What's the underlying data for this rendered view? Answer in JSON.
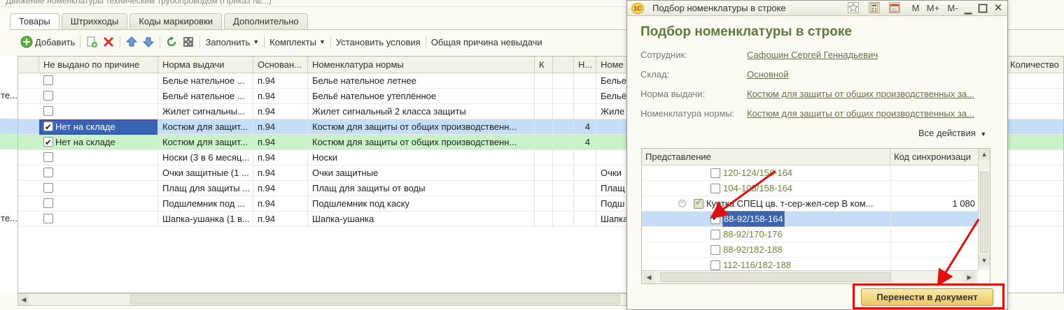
{
  "main": {
    "window_title_fragment": "Движение номенклатуры техническим трубопроводом (Приказ №...)",
    "tabs": [
      {
        "label": "Товары",
        "active": true
      },
      {
        "label": "Штрихкоды",
        "active": false
      },
      {
        "label": "Коды маркировки",
        "active": false
      },
      {
        "label": "Дополнительно",
        "active": false
      }
    ],
    "toolbar": {
      "add_label": "Добавить",
      "add_icon": "plus-circle-icon",
      "copy_icon": "copy-add-icon",
      "delete_icon": "delete-icon",
      "up_icon": "arrow-up-icon",
      "down_icon": "arrow-down-icon",
      "refresh_icon": "refresh-icon",
      "barcode_icon": "barcode-icon",
      "fill_label": "Заполнить",
      "sets_label": "Комплекты",
      "set_conditions_label": "Установить условия",
      "common_reason_label": "Общая причина невыдачи"
    },
    "table": {
      "headers": {
        "reason": "Не выдано по причине",
        "norm": "Норма выдачи",
        "basis": "Основан...",
        "nomenclature": "Номенклатура нормы",
        "k": "К",
        "n": "Н...",
        "nomenclature2": "Номе",
        "quantity": "Количество"
      },
      "rows": [
        {
          "left": "",
          "checked": false,
          "reason": "",
          "norm": "Белье нательное ...",
          "basis": "п.94",
          "nomenclature": "Белье нательное летнее",
          "n": "",
          "nom2": "Белье"
        },
        {
          "left": "те...",
          "checked": false,
          "reason": "",
          "norm": "Бельё нательное ...",
          "basis": "п.94",
          "nomenclature": "Бельё нательное утеплённое",
          "n": "",
          "nom2": "Бельё"
        },
        {
          "left": "",
          "checked": false,
          "reason": "",
          "norm": "Жилет сигнальны...",
          "basis": "п.94",
          "nomenclature": "Жилет сигнальный 2 класса защиты",
          "n": "",
          "nom2": "Жиле"
        },
        {
          "left": "",
          "checked": true,
          "reason": "Нет на складе",
          "norm": "Костюм для защит...",
          "basis": "п.94",
          "nomenclature": "Костюм для защиты от общих производственн...",
          "n": "4",
          "nom2": "",
          "style": "sel"
        },
        {
          "left": "",
          "checked": true,
          "reason": "Нет на складе",
          "norm": "Костюм для защит...",
          "basis": "п.94",
          "nomenclature": "Костюм для защиты от общих производственн...",
          "n": "4",
          "nom2": "",
          "style": "green"
        },
        {
          "left": "",
          "checked": false,
          "reason": "",
          "norm": "Носки (3 в 6 месяц...",
          "basis": "п.94",
          "nomenclature": "Носки",
          "n": "",
          "nom2": ""
        },
        {
          "left": "",
          "checked": false,
          "reason": "",
          "norm": "Очки защитные (1 ...",
          "basis": "п.94",
          "nomenclature": "Очки защитные",
          "n": "",
          "nom2": "Очки"
        },
        {
          "left": "",
          "checked": false,
          "reason": "",
          "norm": "Плащ для защиты ...",
          "basis": "п.94",
          "nomenclature": "Плащ для защиты от воды",
          "n": "",
          "nom2": "Плащ"
        },
        {
          "left": "",
          "checked": false,
          "reason": "",
          "norm": "Подшлемник под ...",
          "basis": "п.94",
          "nomenclature": "Подшлемник под каску",
          "n": "",
          "nom2": "Подш"
        },
        {
          "left": "те...",
          "checked": false,
          "reason": "",
          "norm": "Шапка-ушанка (1 в...",
          "basis": "п.94",
          "nomenclature": "Шапка-ушанка",
          "n": "",
          "nom2": "Шапка"
        }
      ]
    }
  },
  "popup": {
    "window_title": "Подбор номенклатуры в строке",
    "heading": "Подбор номенклатуры в строке",
    "title_buttons": [
      "M",
      "M+",
      "M-"
    ],
    "fields": [
      {
        "label": "Сотрудник:",
        "value": "Сафошин Сергей Геннадьевич"
      },
      {
        "label": "Склад:",
        "value": "Основной"
      },
      {
        "label": "Норма выдачи:",
        "value": "Костюм для защиты от общих производственных за..."
      },
      {
        "label": "Номенклатура нормы:",
        "value": "Костюм для защиты от общих производственных за..."
      }
    ],
    "all_actions": "Все действия",
    "tree": {
      "headers": {
        "representation": "Представление",
        "sync_code": "Код синхронизаци"
      },
      "rows": [
        {
          "text": "120-124/158-164",
          "level": 2,
          "checked": false,
          "code": ""
        },
        {
          "text": "104-108/158-164",
          "level": 2,
          "checked": false,
          "code": ""
        },
        {
          "text": "Куртка СПЕЦ  цв. т-сер-жел-сер В ком...",
          "level": 1,
          "checked": "partial",
          "code": "1 080"
        },
        {
          "text": "88-92/158-164",
          "level": 2,
          "checked": true,
          "code": "",
          "selected": true
        },
        {
          "text": "88-92/170-176",
          "level": 2,
          "checked": false,
          "code": ""
        },
        {
          "text": "88-92/182-188",
          "level": 2,
          "checked": false,
          "code": ""
        },
        {
          "text": "112-116/182-188",
          "level": 2,
          "checked": false,
          "code": ""
        }
      ]
    },
    "transfer_button": "Перенести в документ"
  },
  "colors": {
    "accent_green": "#5e7a3a",
    "selection_blue": "#c5ddf6",
    "row_green": "#caf2c9",
    "annotation_red": "#e01010",
    "button_gold": "#eac868"
  }
}
